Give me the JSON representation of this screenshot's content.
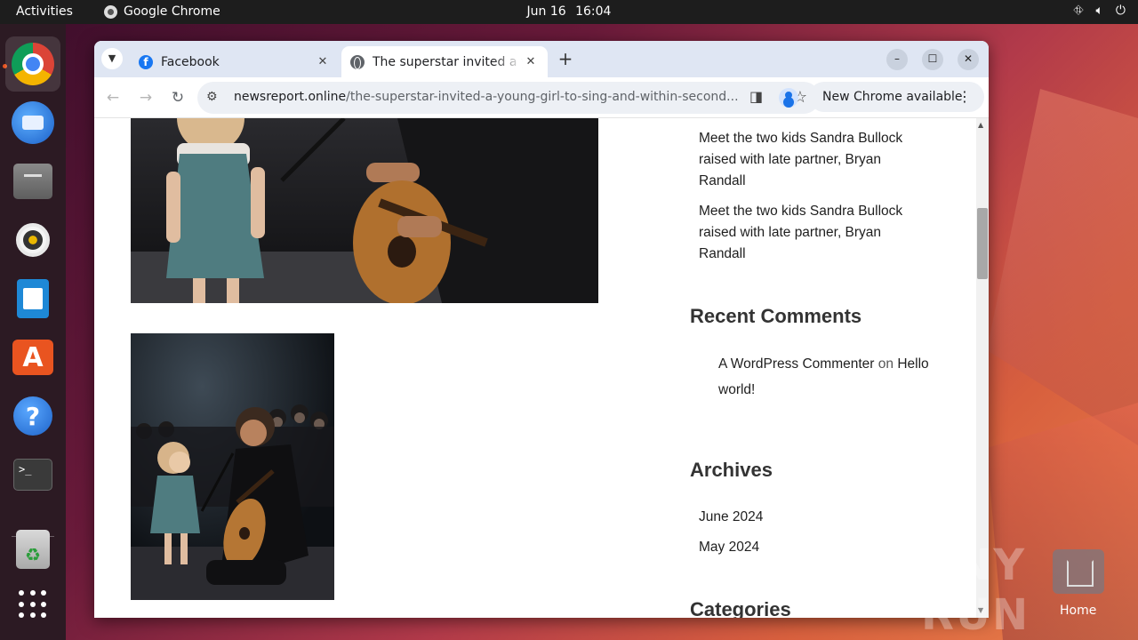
{
  "topbar": {
    "activities": "Activities",
    "app_name": "Google Chrome",
    "date": "Jun 16",
    "time": "16:04"
  },
  "dock": {
    "items": [
      "Google Chrome",
      "Thunderbird Mail",
      "Files",
      "Rhythmbox",
      "LibreOffice Writer",
      "Ubuntu Software",
      "Help",
      "Terminal",
      "Trash",
      "Show Applications"
    ],
    "terminal_glyph": ">_",
    "store_glyph": "A",
    "help_glyph": "?",
    "trash_glyph": "♻"
  },
  "browser": {
    "tabs": [
      {
        "title": "Facebook",
        "favicon": "facebook-icon"
      },
      {
        "title": "The superstar invited a young girl to sing and within seconds",
        "favicon": "globe-icon",
        "active": true
      }
    ],
    "url_domain": "newsreport.online",
    "url_path": "/the-superstar-invited-a-young-girl-to-sing-and-within-second...",
    "update_button": "New Chrome available"
  },
  "page": {
    "recent_posts": [
      "Meet the two kids Sandra Bullock raised with late partner, Bryan Randall",
      "Meet the two kids Sandra Bullock raised with late partner, Bryan Randall"
    ],
    "recent_comments_title": "Recent Comments",
    "comment": {
      "author": "A WordPress Commenter",
      "on": "on",
      "post": "Hello world!"
    },
    "archives_title": "Archives",
    "archives": [
      "June 2024",
      "May 2024"
    ],
    "categories_title": "Categories"
  },
  "desktop": {
    "watermark": "ANY RUN",
    "home_label": "Home"
  },
  "colors": {
    "ubuntu_orange": "#e95420",
    "chrome_tabbar": "#dfe6f3",
    "facebook_blue": "#1877f2"
  }
}
